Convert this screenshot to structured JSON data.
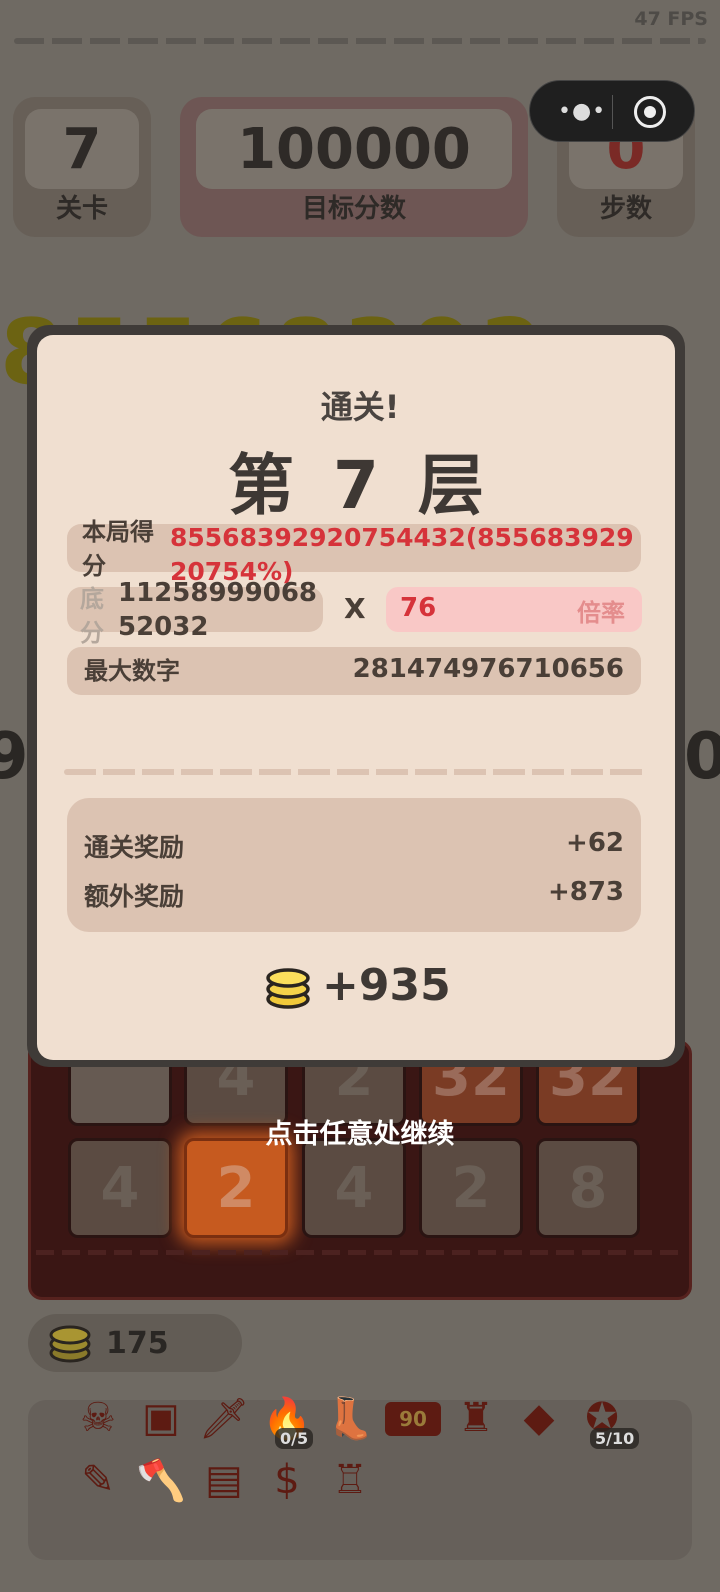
{
  "fps": "47 FPS",
  "header": {
    "level": {
      "value": "7",
      "label": "关卡"
    },
    "target": {
      "value": "100000",
      "label": "目标分数"
    },
    "steps": {
      "value": "0",
      "label": "步数"
    }
  },
  "background": {
    "big_score_partial": "85568392",
    "left_num": "9",
    "right_num": "0"
  },
  "board": {
    "rows": [
      [
        "",
        "4",
        "2",
        "32",
        "32"
      ],
      [
        "4",
        "2",
        "4",
        "2",
        "8"
      ]
    ]
  },
  "continue_hint": "点击任意处继续",
  "coins": {
    "value": "175"
  },
  "items": [
    {
      "icon": "demon-mask-icon",
      "glyph": "☠",
      "badge": ""
    },
    {
      "icon": "ice-cube-icon",
      "glyph": "▣",
      "badge": ""
    },
    {
      "icon": "sword-icon",
      "glyph": "🗡",
      "badge": ""
    },
    {
      "icon": "fire-chest-icon",
      "glyph": "🔥",
      "badge": "0/5"
    },
    {
      "icon": "boot-icon",
      "glyph": "👢",
      "badge": ""
    },
    {
      "icon": "ticket-90-icon",
      "glyph": "90",
      "badge": ""
    },
    {
      "icon": "armor-boot-icon",
      "glyph": "♜",
      "badge": ""
    },
    {
      "icon": "gem-coin-icon",
      "glyph": "◆",
      "badge": ""
    },
    {
      "icon": "compass-icon",
      "glyph": "✪",
      "badge": "5/10"
    },
    {
      "icon": "pen-icon",
      "glyph": "✎",
      "badge": ""
    },
    {
      "icon": "axe-icon",
      "glyph": "🪓",
      "badge": ""
    },
    {
      "icon": "card-icon",
      "glyph": "▤",
      "badge": ""
    },
    {
      "icon": "dollar-coin-icon",
      "glyph": "$",
      "badge": ""
    },
    {
      "icon": "candle-icon",
      "glyph": "♖",
      "badge": ""
    }
  ],
  "modal": {
    "title": "通关!",
    "floor": "第 7 层",
    "score_label": "本局得分",
    "score_value": "85568392920754432(85568392920754%)",
    "base_label": "底分",
    "base_value": "1125899906852032",
    "times": "X",
    "multiplier_value": "76",
    "multiplier_label": "倍率",
    "max_label": "最大数字",
    "max_value": "281474976710656",
    "rewards": [
      {
        "label": "通关奖励",
        "value": "+62"
      },
      {
        "label": "额外奖励",
        "value": "+873"
      }
    ],
    "total": "+935"
  },
  "colors": {
    "accent_red": "#d6333a",
    "modal_bg": "#f0dfd0",
    "row_bg": "#dcc3b2",
    "multiplier_bg": "#f9c8c6"
  }
}
